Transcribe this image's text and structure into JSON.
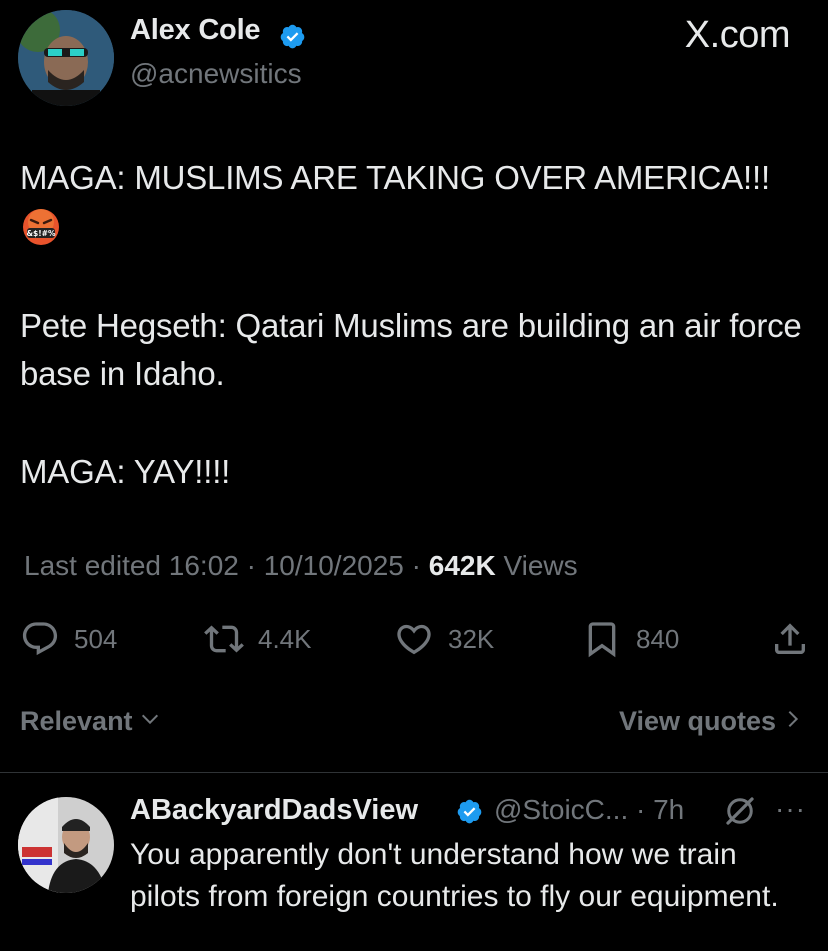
{
  "post": {
    "author_name": "Alex Cole",
    "author_handle": "@acnewsitics",
    "brand": "X.com",
    "text_line1": "MAGA: MUSLIMS ARE TAKING OVER AMERICA!!!",
    "emoji_label": "&$!#%",
    "text_para2": "Pete Hegseth: Qatari Muslims are building an air force base in Idaho.",
    "text_para3": "MAGA: YAY!!!!",
    "edited_label": "Last edited 16:02 · 10/10/2025",
    "separator": "·",
    "views_count": "642K",
    "views_label": "Views"
  },
  "actions": {
    "replies": "504",
    "reposts": "4.4K",
    "likes": "32K",
    "bookmarks": "840"
  },
  "sort": {
    "relevant_label": "Relevant",
    "view_quotes_label": "View quotes"
  },
  "reply": {
    "author_name": "ABackyardDadsView",
    "author_handle_time": "@StoicC... · 7h",
    "more": "···",
    "text": "You apparently don't understand how we train pilots from foreign countries to fly our equipment."
  },
  "colors": {
    "background": "#000000",
    "text": "#e7e9ea",
    "muted": "#71767b",
    "verified_blue": "#1d9bf0",
    "divider": "#2f3336"
  },
  "icons": [
    "verified-badge-icon",
    "angry-emoji-icon",
    "reply-icon",
    "repost-icon",
    "like-icon",
    "bookmark-icon",
    "share-icon",
    "chevron-down-icon",
    "chevron-right-icon",
    "grok-icon"
  ]
}
